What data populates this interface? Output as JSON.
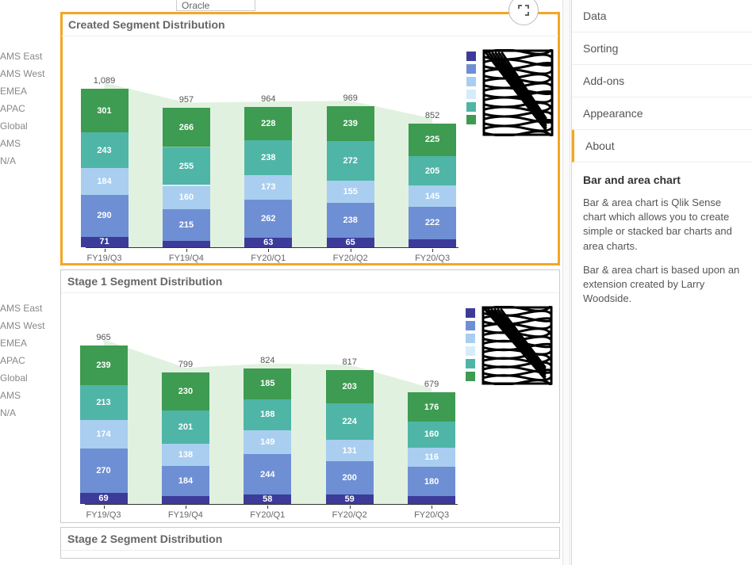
{
  "top_stray_label": "Oracle",
  "filters": [
    "AMS East",
    "AMS West",
    "EMEA",
    "APAC",
    "Global",
    "AMS",
    "N/A"
  ],
  "categories": [
    "FY19/Q3",
    "FY19/Q4",
    "FY20/Q1",
    "FY20/Q2",
    "FY20/Q3"
  ],
  "x_positions_pct": [
    5,
    27,
    49,
    71,
    93
  ],
  "series_colors": [
    "#3d3b99",
    "#6f8fd4",
    "#a9cef0",
    "#d7ecfb",
    "#4fb5a7",
    "#82c79a",
    "#3e9b52"
  ],
  "legend_colors": [
    "#3d3b99",
    "#6f8fd4",
    "#a9cef0",
    "#d7ecfb",
    "#4fb5a7",
    "#3e9b52"
  ],
  "chart_data": [
    {
      "id": "chart1",
      "type": "bar",
      "title": "Created Segment Distribution",
      "selected": true,
      "totals": [
        1089,
        957,
        964,
        969,
        852
      ],
      "series": [
        {
          "name": "s0",
          "values": [
            71,
            46,
            63,
            65,
            55
          ]
        },
        {
          "name": "s1",
          "values": [
            290,
            215,
            262,
            238,
            222
          ]
        },
        {
          "name": "s2",
          "values": [
            184,
            160,
            173,
            155,
            145
          ]
        },
        {
          "name": "labeled_light",
          "values": [
            null,
            null,
            null,
            null,
            null
          ]
        },
        {
          "name": "s4",
          "values": [
            243,
            255,
            238,
            272,
            205
          ]
        },
        {
          "name": "area_top",
          "values": [
            null,
            null,
            null,
            null,
            null
          ]
        },
        {
          "name": "s6",
          "values": [
            301,
            266,
            228,
            239,
            225
          ]
        }
      ],
      "visible_segment_labels": [
        [
          71,
          290,
          184,
          243,
          301
        ],
        [
          null,
          215,
          160,
          255,
          266
        ],
        [
          63,
          262,
          173,
          238,
          228
        ],
        [
          65,
          238,
          155,
          272,
          239
        ],
        [
          null,
          222,
          145,
          205,
          225
        ]
      ]
    },
    {
      "id": "chart2",
      "type": "bar",
      "title": "Stage 1 Segment Distribution",
      "selected": false,
      "totals": [
        965,
        799,
        824,
        817,
        679
      ],
      "series": [
        {
          "name": "s0",
          "values": [
            69,
            46,
            58,
            59,
            47
          ]
        },
        {
          "name": "s1",
          "values": [
            270,
            184,
            244,
            200,
            180
          ]
        },
        {
          "name": "s2",
          "values": [
            174,
            138,
            149,
            131,
            116
          ]
        },
        {
          "name": "labeled_light",
          "values": [
            null,
            null,
            null,
            null,
            null
          ]
        },
        {
          "name": "s4",
          "values": [
            213,
            201,
            188,
            224,
            160
          ]
        },
        {
          "name": "area_top",
          "values": [
            null,
            null,
            null,
            null,
            null
          ]
        },
        {
          "name": "s6",
          "values": [
            239,
            230,
            185,
            203,
            176
          ]
        }
      ],
      "visible_segment_labels": [
        [
          69,
          270,
          174,
          213,
          239
        ],
        [
          null,
          184,
          138,
          201,
          230
        ],
        [
          58,
          244,
          149,
          188,
          185
        ],
        [
          59,
          200,
          131,
          224,
          203
        ],
        [
          null,
          180,
          116,
          160,
          176
        ]
      ]
    },
    {
      "id": "chart3",
      "type": "bar",
      "title": "Stage 2 Segment Distribution",
      "selected": false,
      "totals": [],
      "series": [],
      "visible_segment_labels": []
    }
  ],
  "side_panel": {
    "items": [
      "Data",
      "Sorting",
      "Add-ons",
      "Appearance",
      "About"
    ],
    "active_index": 4,
    "about_heading": "Bar and area chart",
    "about_p1": "Bar & area chart is Qlik Sense chart which allows you to create simple or stacked bar charts and area charts.",
    "about_p2": "Bar & area chart is based upon an extension created by Larry Woodside."
  }
}
